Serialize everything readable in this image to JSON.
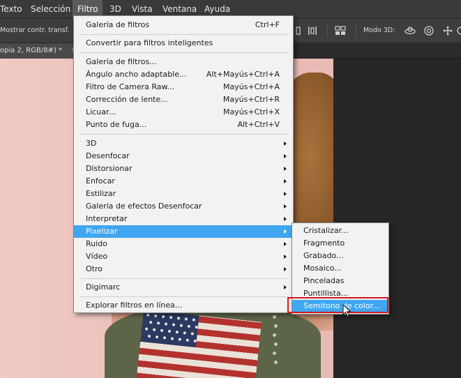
{
  "menubar": {
    "items": [
      "Texto",
      "Selección",
      "Filtro",
      "3D",
      "Vista",
      "Ventana",
      "Ayuda"
    ],
    "active_index": 2
  },
  "options_bar": {
    "show_transform_label": "Mostrar contr. transf.",
    "mode_3d_label": "Modo 3D:"
  },
  "document": {
    "tab_title": "opia 2, RGB/8#) *",
    "tab_close": "×"
  },
  "filter_menu": {
    "items": [
      {
        "label": "Galería de filtros",
        "shortcut": "Ctrl+F"
      },
      {
        "label": "Convertir para filtros inteligentes",
        "shortcut": ""
      },
      {
        "label": "Galería de filtros...",
        "shortcut": ""
      },
      {
        "label": "Ángulo ancho adaptable...",
        "shortcut": "Alt+Mayús+Ctrl+A"
      },
      {
        "label": "Filtro de Camera Raw...",
        "shortcut": "Mayús+Ctrl+A"
      },
      {
        "label": "Corrección de lente...",
        "shortcut": "Mayús+Ctrl+R"
      },
      {
        "label": "Licuar...",
        "shortcut": "Mayús+Ctrl+X"
      },
      {
        "label": "Punto de fuga...",
        "shortcut": "Alt+Ctrl+V"
      },
      {
        "label": "3D",
        "submenu": true
      },
      {
        "label": "Desenfocar",
        "submenu": true
      },
      {
        "label": "Distorsionar",
        "submenu": true
      },
      {
        "label": "Enfocar",
        "submenu": true
      },
      {
        "label": "Estilizar",
        "submenu": true
      },
      {
        "label": "Galería de efectos Desenfocar",
        "submenu": true
      },
      {
        "label": "Interpretar",
        "submenu": true
      },
      {
        "label": "Pixelizar",
        "submenu": true,
        "highlighted": true
      },
      {
        "label": "Ruido",
        "submenu": true
      },
      {
        "label": "Vídeo",
        "submenu": true
      },
      {
        "label": "Otro",
        "submenu": true
      },
      {
        "label": "Digimarc",
        "submenu": true
      },
      {
        "label": "Explorar filtros en línea...",
        "shortcut": ""
      }
    ]
  },
  "pixelizar_submenu": {
    "items": [
      {
        "label": "Cristalizar..."
      },
      {
        "label": "Fragmento"
      },
      {
        "label": "Grabado..."
      },
      {
        "label": "Mosaico..."
      },
      {
        "label": "Pinceladas"
      },
      {
        "label": "Puntillista..."
      },
      {
        "label": "Semitono de color...",
        "highlighted": true
      }
    ]
  },
  "colors": {
    "menu_highlight": "#3fa6ef",
    "annotation_box": "#d4171d",
    "menubar_bg": "#3a3a3a"
  }
}
